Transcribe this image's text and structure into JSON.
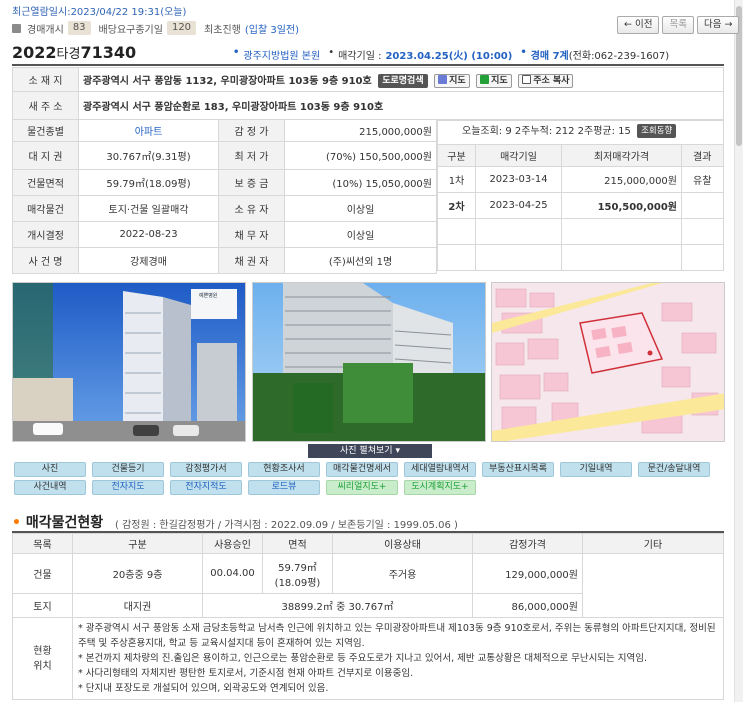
{
  "header": {
    "last_viewed": "최근열람일시:2023/04/22 19:31(오늘)",
    "stats": [
      {
        "label": "경매개시",
        "value": "83"
      },
      {
        "label": "배당요구종기일",
        "value": "120"
      }
    ],
    "status_prefix": "최초진행",
    "status_link": "(입찰 3일전)",
    "nav": {
      "prev": "← 이전",
      "list": "목록",
      "next": "다음 →"
    }
  },
  "case": {
    "year": "2022",
    "type": "타경",
    "number": "71340",
    "court": "광주지방법원 본원",
    "sale_date_label": "매각기일 :",
    "sale_date": "2023.04.25(火) (10:00)",
    "dept": "경매 7계",
    "phone": "(전화:062-239-1607)"
  },
  "info": {
    "address_label": "소 재 지",
    "address": "광주광역시 서구 풍암동 1132, 우미광장아파트 103동 9층 910호",
    "road_search": "도로명검색",
    "map1": "지도",
    "map2": "지도",
    "copy": "주소 복사",
    "new_address_label": "새 주 소",
    "new_address": "광주광역시 서구 풍암순환로 183, 우미광장아파트 103동 9층 910호",
    "rows": [
      {
        "l1": "물건종별",
        "v1": "아파트",
        "l2": "감 정 가",
        "v2": "215,000,000원"
      },
      {
        "l1": "대 지 권",
        "v1": "30.767㎡(9.31평)",
        "l2": "최 저 가",
        "v2": "(70%) 150,500,000원"
      },
      {
        "l1": "건물면적",
        "v1": "59.79㎡(18.09평)",
        "l2": "보 증 금",
        "v2": "(10%) 15,050,000원"
      },
      {
        "l1": "매각물건",
        "v1": "토지·건물 일괄매각",
        "l2": "소 유 자",
        "v2": "이상일"
      },
      {
        "l1": "개시결정",
        "v1": "2022-08-23",
        "l2": "채 무 자",
        "v2": "이상일"
      },
      {
        "l1": "사 건 명",
        "v1": "강제경매",
        "l2": "채 권 자",
        "v2": "(주)씨선외 1명"
      }
    ],
    "views": "오늘조회: 9 2주누적: 212 2주평균: 15",
    "views_btn": "조회동향",
    "history_headers": [
      "구분",
      "매각기일",
      "최저매각가격",
      "결과"
    ],
    "history": [
      {
        "round": "1차",
        "date": "2023-03-14",
        "price": "215,000,000원",
        "result": "유찰"
      },
      {
        "round": "2차",
        "date": "2023-04-25",
        "price": "150,500,000원",
        "result": ""
      }
    ]
  },
  "photos": {
    "signs": [
      "예쁜병원"
    ],
    "view_all": "사진 펼쳐보기"
  },
  "link_buttons": [
    "사진",
    "건물등기",
    "감정평가서",
    "현황조사서",
    "매각물건명세서",
    "세대열람내역서",
    "부동산표시목록",
    "기일내역",
    "문건/송달내역",
    "사건내역",
    "전자지도",
    "전자지적도",
    "로드뷰",
    "씨리얼지도+",
    "도시계획지도+"
  ],
  "goods": {
    "title": "매각물건현황",
    "meta": "( 감정원 : 한길감정평가 / 가격시점 : 2022.09.09 / 보존등기일 : 1999.05.06 )",
    "headers": [
      "목록",
      "구분",
      "사용승인",
      "면적",
      "이용상태",
      "감정가격",
      "기타"
    ],
    "building": {
      "label": "건물",
      "kind": "20층중 9층",
      "approval": "00.04.00",
      "area1": "59.79㎡",
      "area2": "(18.09평)",
      "use": "주거용",
      "price": "129,000,000원"
    },
    "land": {
      "label": "토지",
      "kind": "대지권",
      "area": "38899.2㎡ 중 30.767㎡",
      "price": "86,000,000원"
    },
    "status_label1": "현황",
    "status_label2": "위치",
    "desc": [
      "* 광주광역시 서구 풍암동 소재 금당초등학교 남서측 인근에 위치하고 있는 우미광장아파트내 제103동 9층 910호로서, 주위는 동류형의 아파트단지지대, 정비된 주택 및 주상혼용지대, 학교 등 교육시설지대 등이 혼재하여 있는 지역임.",
      "* 본건까지 제차량의 진.출입은 용이하고, 인근으로는 풍암순환로 등 주요도로가 지나고 있어서, 제반 교통상황은 대체적으로 무난시되는 지역임.",
      "* 사다리형태의 자체지반 평탄한 토지로서, 기준시점 현재 아파트 건부지로 이용중임.",
      "* 단지내 포장도로 개설되어 있으며, 외곽공도와 연계되어 있음."
    ]
  }
}
